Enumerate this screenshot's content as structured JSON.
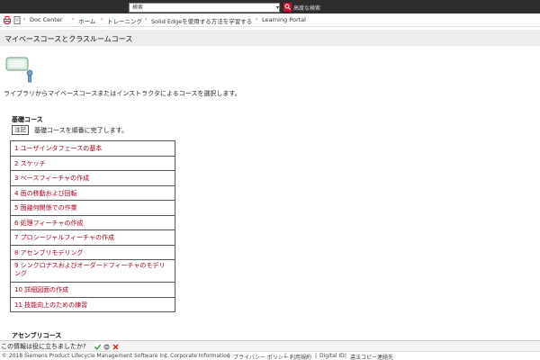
{
  "topbar": {
    "search_placeholder": "検索",
    "advanced_search": "高度な検索"
  },
  "breadcrumb": {
    "items": [
      "Doc Center",
      "ホーム",
      "トレーニング",
      "Solid Edgeを使用する方法を学習する",
      "Learning Portal"
    ]
  },
  "page_title": "マイベースコースとクラスルームコース",
  "intro": "ライブラリからマイベースコースまたはインストラクタによるコースを選択します。",
  "basic_course": {
    "heading": "基礎コース",
    "note_badge": "注記",
    "note_text": "基礎コースを順番に完了します。",
    "courses": [
      "1 ユーザインタフェースの基本",
      "2 スケッチ",
      "3 ベースフィーチャの作成",
      "4 面の移動および回転",
      "5 面幾何関係での作業",
      "6 処理フィーチャの作成",
      "7 プロシージャルフィーチャの作成",
      "8 アセンブリモデリング",
      "9 シンクロナスおよびオーダードフィーチャのモデリング",
      "10 詳細図面の作成",
      "11 技能向上のための練習"
    ]
  },
  "assembly_heading": "アセンブリコース",
  "feedback": {
    "question": "この情報は役に立ちましたか?"
  },
  "footer": {
    "copyright": "© 2018 Siemens Product Lifecycle Management Software Inc.",
    "links": [
      "Corporate Information",
      "プライバシー ポリシー",
      "利用規約",
      "Digital ID",
      "違法コピー連絡先"
    ]
  },
  "colors": {
    "accent": "#a8001d",
    "topbar": "#2e2e2e",
    "title_band": "#ececec"
  }
}
